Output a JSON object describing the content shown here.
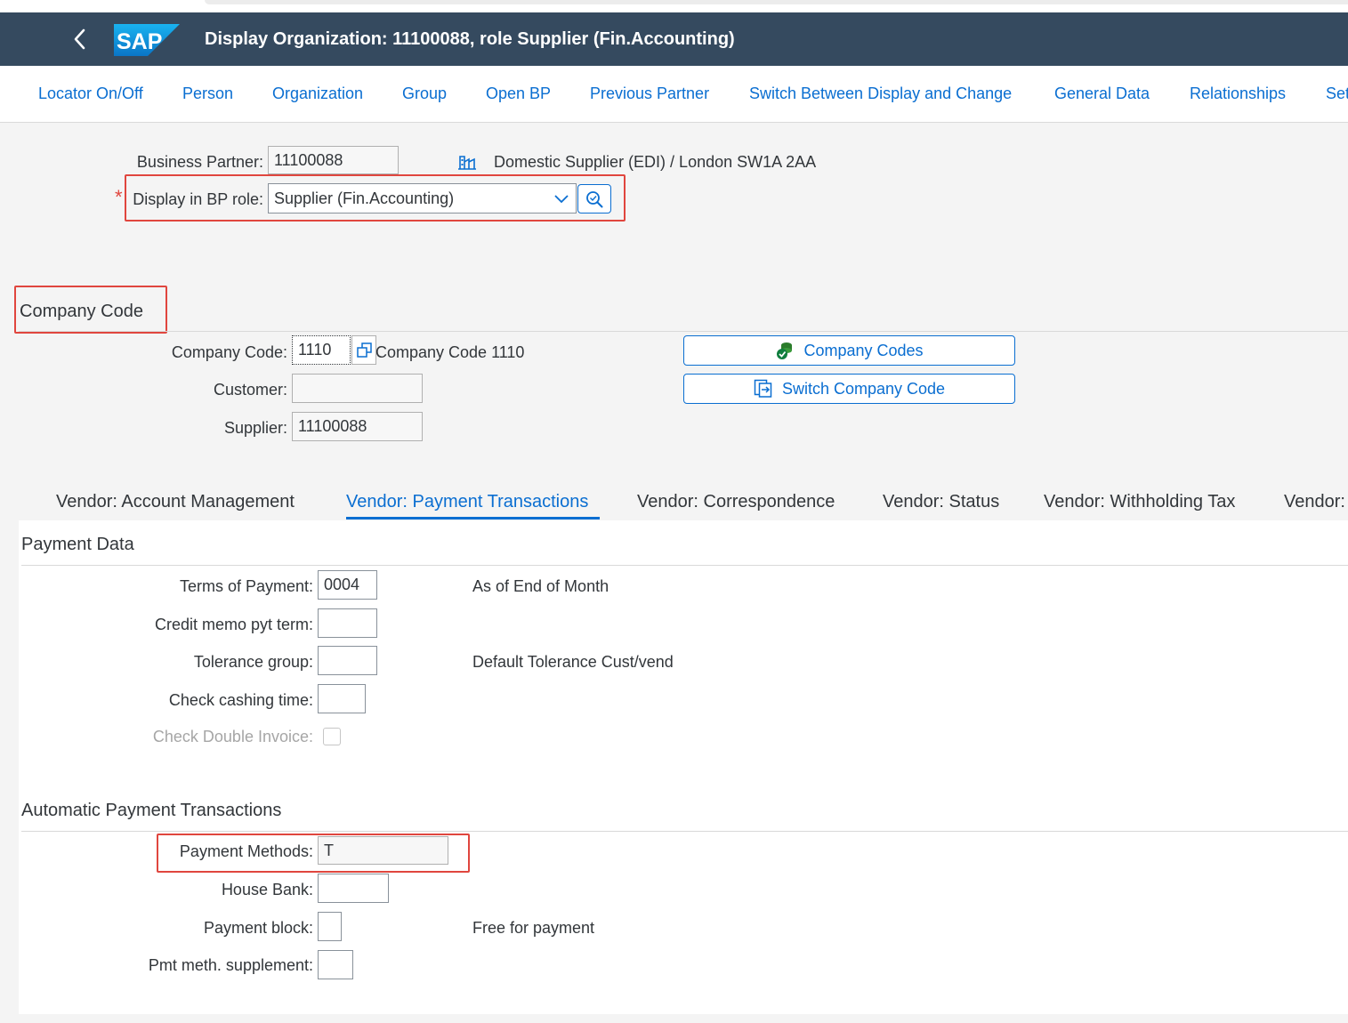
{
  "shell": {
    "title": "Display Organization: 11100088, role Supplier (Fin.Accounting)",
    "logo_text": "SAP",
    "brand_color": "#354a5f",
    "accent_color": "#0a6ed1"
  },
  "toolbar": {
    "items": [
      "Locator On/Off",
      "Person",
      "Organization",
      "Group",
      "Open BP",
      "Previous Partner",
      "Switch Between Display and Change",
      "General Data",
      "Relationships",
      "Set"
    ]
  },
  "header": {
    "bp_label": "Business Partner:",
    "bp_value": "11100088",
    "bp_description": "Domestic Supplier (EDI) / London SW1A 2AA",
    "required_mark": "*",
    "role_label": "Display in BP role:",
    "role_value": "Supplier (Fin.Accounting)"
  },
  "company_code_section": {
    "title": "Company Code",
    "cc_label": "Company Code:",
    "cc_value": "1110",
    "cc_description": "Company Code 1110",
    "customer_label": "Customer:",
    "customer_value": "",
    "supplier_label": "Supplier:",
    "supplier_value": "11100088",
    "btn_company_codes": "Company Codes",
    "btn_switch_company_code": "Switch Company Code"
  },
  "tabs": [
    "Vendor: Account Management",
    "Vendor: Payment Transactions",
    "Vendor: Correspondence",
    "Vendor: Status",
    "Vendor: Withholding Tax",
    "Vendor:"
  ],
  "payment_data": {
    "title": "Payment Data",
    "terms_label": "Terms of Payment:",
    "terms_value": "0004",
    "terms_description": "As of End of Month",
    "credit_memo_label": "Credit memo pyt term:",
    "credit_memo_value": "",
    "tolerance_label": "Tolerance group:",
    "tolerance_value": "",
    "tolerance_description": "Default Tolerance Cust/vend",
    "check_cashing_label": "Check cashing time:",
    "check_cashing_value": "",
    "check_double_label": "Check Double Invoice:",
    "check_double_checked": false
  },
  "auto_payment": {
    "title": "Automatic Payment Transactions",
    "methods_label": "Payment Methods:",
    "methods_value": "T",
    "house_bank_label": "House Bank:",
    "house_bank_value": "",
    "block_label": "Payment block:",
    "block_value": "",
    "block_description": "Free for payment",
    "supplement_label": "Pmt meth. supplement:",
    "supplement_value": ""
  }
}
